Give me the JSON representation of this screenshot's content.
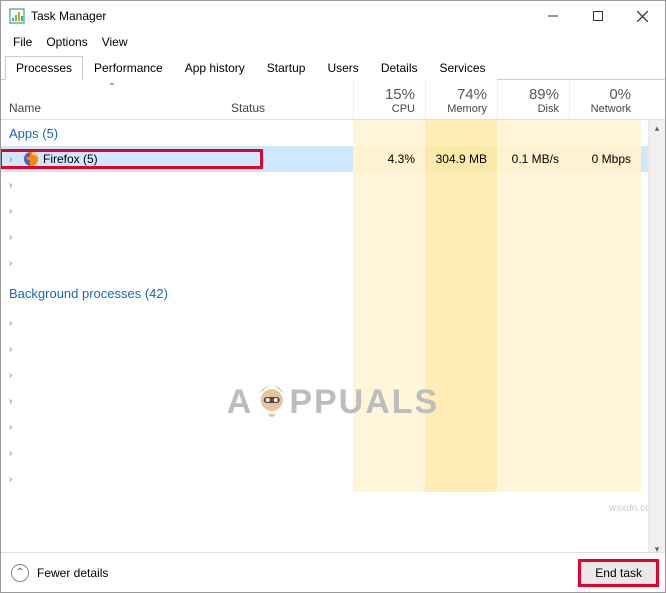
{
  "window": {
    "title": "Task Manager"
  },
  "menu": {
    "file": "File",
    "options": "Options",
    "view": "View"
  },
  "tabs": {
    "processes": "Processes",
    "performance": "Performance",
    "app_history": "App history",
    "startup": "Startup",
    "users": "Users",
    "details": "Details",
    "services": "Services"
  },
  "columns": {
    "name": "Name",
    "status": "Status",
    "cpu_pct": "15%",
    "cpu_lbl": "CPU",
    "mem_pct": "74%",
    "mem_lbl": "Memory",
    "disk_pct": "89%",
    "disk_lbl": "Disk",
    "net_pct": "0%",
    "net_lbl": "Network"
  },
  "groups": {
    "apps": "Apps (5)",
    "bg": "Background processes (42)"
  },
  "firefox": {
    "name": "Firefox (5)",
    "cpu": "4.3%",
    "mem": "304.9 MB",
    "disk": "0.1 MB/s",
    "net": "0 Mbps"
  },
  "footer": {
    "fewer": "Fewer details",
    "end_task": "End task"
  },
  "watermark": {
    "a": "A",
    "ppuals": "PPUALS"
  },
  "credit": "wsxdn.com"
}
